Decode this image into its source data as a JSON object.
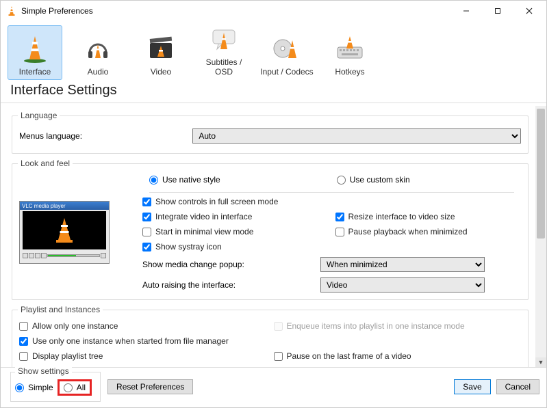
{
  "window": {
    "title": "Simple Preferences"
  },
  "categories": [
    {
      "key": "interface",
      "label": "Interface",
      "selected": true
    },
    {
      "key": "audio",
      "label": "Audio"
    },
    {
      "key": "video",
      "label": "Video"
    },
    {
      "key": "subs",
      "label": "Subtitles / OSD"
    },
    {
      "key": "input",
      "label": "Input / Codecs"
    },
    {
      "key": "hotkeys",
      "label": "Hotkeys"
    }
  ],
  "page": {
    "title": "Interface Settings"
  },
  "language": {
    "group": "Language",
    "menus_label": "Menus language:",
    "value": "Auto"
  },
  "look": {
    "group": "Look and feel",
    "native": "Use native style",
    "custom": "Use custom skin",
    "show_controls": "Show controls in full screen mode",
    "integrate_video": "Integrate video in interface",
    "resize_to_video": "Resize interface to video size",
    "start_minimal": "Start in minimal view mode",
    "pause_minimized": "Pause playback when minimized",
    "systray": "Show systray icon",
    "popup_label": "Show media change popup:",
    "popup_value": "When minimized",
    "autoraise_label": "Auto raising the interface:",
    "autoraise_value": "Video"
  },
  "playlist": {
    "group": "Playlist and Instances",
    "one_instance": "Allow only one instance",
    "enqueue": "Enqueue items into playlist in one instance mode",
    "one_from_fm": "Use only one instance when started from file manager",
    "display_tree": "Display playlist tree",
    "pause_last_frame": "Pause on the last frame of a video"
  },
  "footer": {
    "show_settings": "Show settings",
    "simple": "Simple",
    "all": "All",
    "reset": "Reset Preferences",
    "save": "Save",
    "cancel": "Cancel"
  }
}
